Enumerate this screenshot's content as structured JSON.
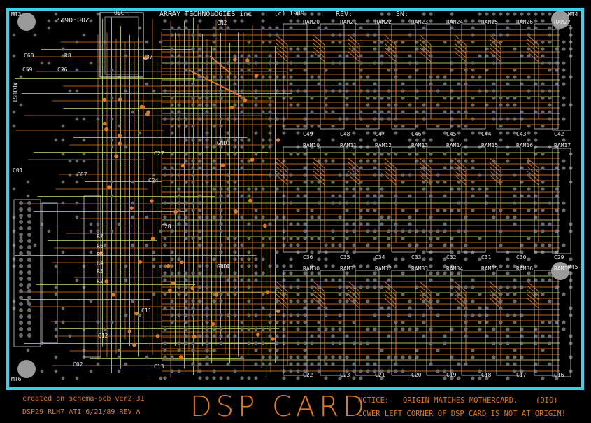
{
  "board": {
    "header_text": "ARRAY TECHNOLOGIES inc",
    "copyright": "(c) 1989",
    "rev_label": "REV:",
    "sn_label": "SN:",
    "part_number": "200-0622",
    "mount_holes": [
      "MT3",
      "MT4",
      "MT5",
      "MT6"
    ],
    "connectors": [
      "CN1",
      "CN2",
      "GND1",
      "GND2"
    ],
    "osc_label": "OSC",
    "adjust_label": "ADJUST"
  },
  "ram_rows": [
    [
      "RAM20",
      "RAM21",
      "RAM22",
      "RAM23",
      "RAM24",
      "RAM25",
      "RAM26",
      "RAM27"
    ],
    [
      "RAM10",
      "RAM11",
      "RAM12",
      "RAM13",
      "RAM14",
      "RAM15",
      "RAM16",
      "RAM17"
    ],
    [
      "RAM30",
      "RAM31",
      "RAM32",
      "RAM33",
      "RAM34",
      "RAM35",
      "RAM36",
      "RAM37"
    ]
  ],
  "cap_rows": [
    [
      "C49",
      "C48",
      "C47",
      "C46",
      "C45",
      "C44",
      "C43",
      "C42"
    ],
    [
      "C36",
      "C35",
      "C34",
      "C33",
      "C32",
      "C31",
      "C30",
      "C29"
    ],
    [
      "C22",
      "C23",
      "C21",
      "C20",
      "C19",
      "C18",
      "C17",
      "C16"
    ]
  ],
  "left_parts": [
    "C60",
    "R8",
    "C59",
    "C26",
    "C37",
    "C01",
    "C07",
    "C02",
    "R7",
    "R6",
    "R5",
    "R4",
    "R3",
    "R2",
    "C24",
    "C27",
    "C28",
    "C11",
    "C12",
    "C13"
  ],
  "footer": {
    "created": "created on schema-pcb ver2.31",
    "info": "DSP29 RLH7 ATI 6/21/89   REV A",
    "title": "DSP CARD",
    "notice_label": "NOTICE:",
    "notice_1": "ORIGIN MATCHES MOTHERCARD.",
    "notice_code": "(DIO)",
    "notice_2": "LOWER LEFT CORNER OF DSP CARD IS NOT AT ORIGIN!"
  },
  "colors": {
    "border": "#3ad0e8",
    "copper_top": "#e07a1f",
    "copper_bottom": "#c6e06a",
    "silk": "#e8e8e8",
    "pad": "#6a6a6a",
    "background": "#000000"
  }
}
